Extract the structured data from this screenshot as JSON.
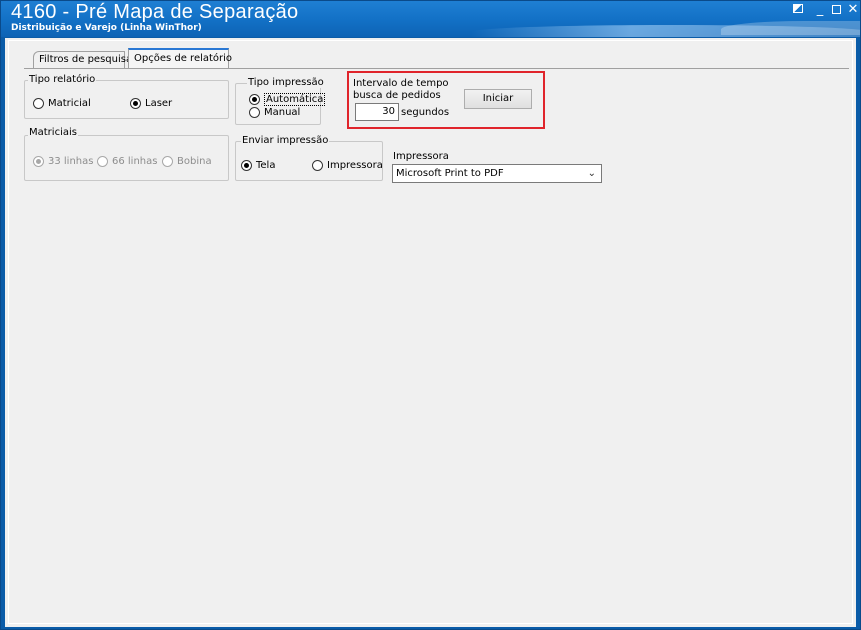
{
  "window": {
    "title": "4160 - Pré Mapa de Separação",
    "subtitle": "Distribuição e Varejo (Linha WinThor)",
    "controls": {
      "restore": "",
      "minimize": "_",
      "maximize": "",
      "close": "✕"
    }
  },
  "tabs": [
    {
      "label": "Filtros de pesquisa",
      "active": false
    },
    {
      "label": "Opções de relatório",
      "active": true
    }
  ],
  "tipo_relatorio": {
    "label": "Tipo relatório",
    "options": [
      {
        "label": "Matricial",
        "selected": false
      },
      {
        "label": "Laser",
        "selected": true
      }
    ]
  },
  "matriciais": {
    "label": "Matriciais",
    "options": [
      {
        "label": "33 linhas",
        "selected": true
      },
      {
        "label": "66 linhas",
        "selected": false
      },
      {
        "label": "Bobina",
        "selected": false
      }
    ]
  },
  "tipo_impressao": {
    "label": "Tipo impressão",
    "options": [
      {
        "label": "Automática",
        "selected": true
      },
      {
        "label": "Manual",
        "selected": false
      }
    ]
  },
  "enviar_impressao": {
    "label": "Enviar impressão",
    "options": [
      {
        "label": "Tela",
        "selected": true
      },
      {
        "label": "Impressora",
        "selected": false
      }
    ]
  },
  "intervalo": {
    "label_line1": "Intervalo de tempo",
    "label_line2": "busca de pedidos",
    "value": "30",
    "unit": "segundos",
    "button": "Iniciar",
    "highlight_color": "#e0242b"
  },
  "impressora": {
    "label": "Impressora",
    "value": "Microsoft Print to PDF"
  }
}
